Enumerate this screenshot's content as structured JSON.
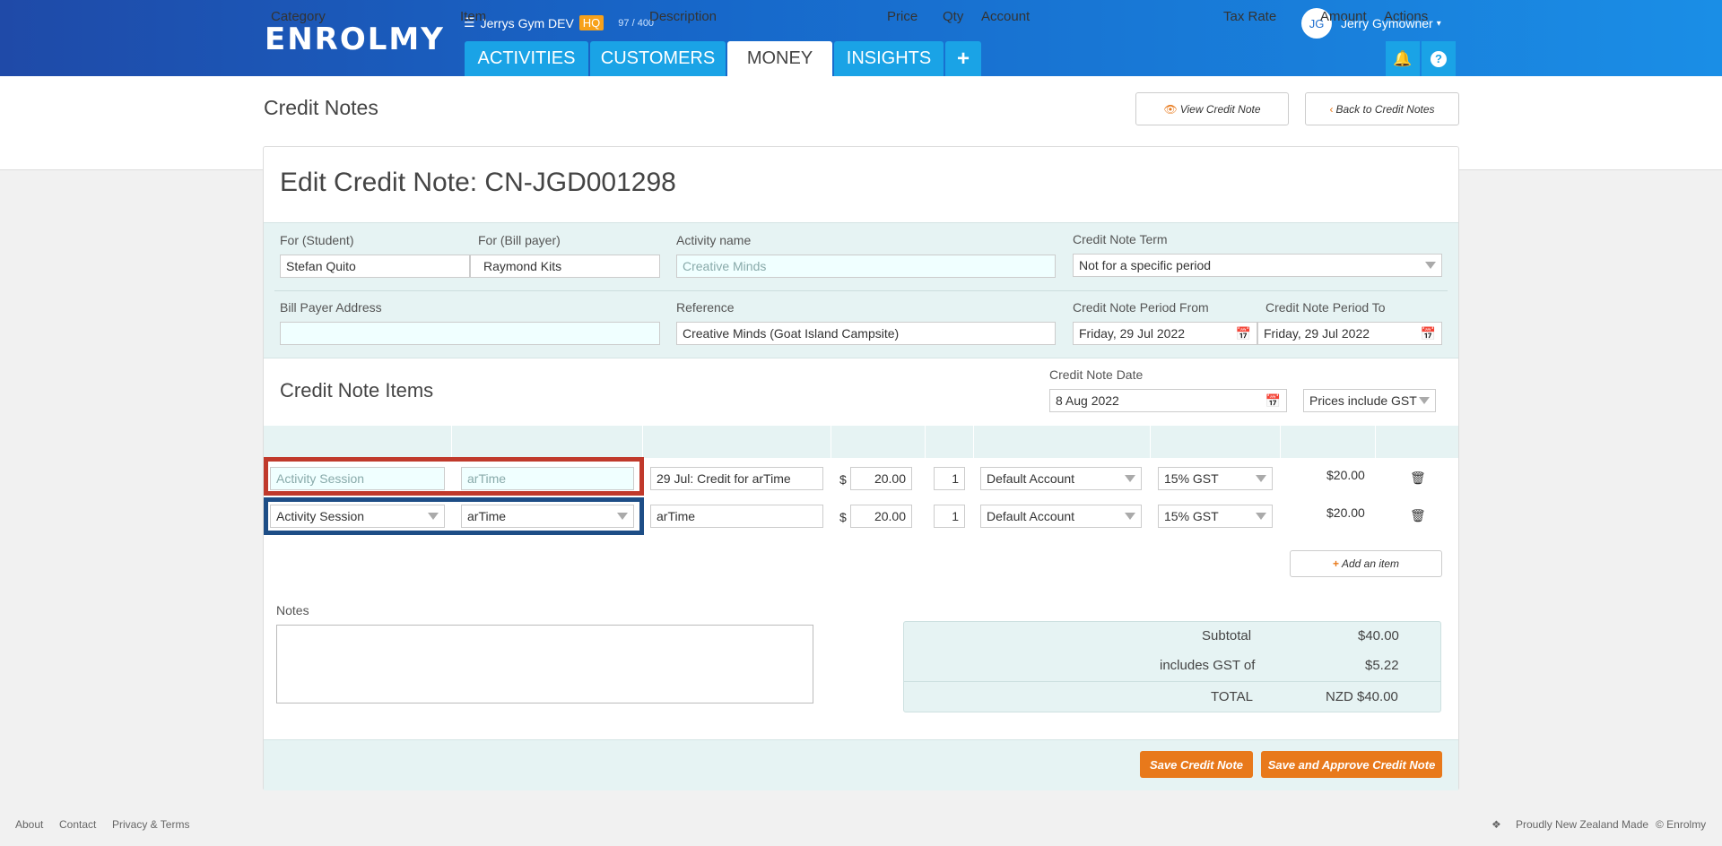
{
  "header": {
    "logo": "ENROLMY",
    "gym_name": "Jerrys Gym DEV",
    "hq_badge": "HQ",
    "quota": "97 / 400",
    "tabs": [
      {
        "label": "ACTIVITIES",
        "active": false
      },
      {
        "label": "CUSTOMERS",
        "active": false
      },
      {
        "label": "MONEY",
        "active": true
      },
      {
        "label": "INSIGHTS",
        "active": false
      }
    ],
    "add_icon": "plus-icon",
    "user_initials": "JG",
    "user_name": "Jerry Gymowner",
    "icons": [
      "bell-icon",
      "help-icon"
    ]
  },
  "page": {
    "title": "Credit Notes",
    "view_button": "View Credit Note",
    "back_button": "Back to Credit Notes"
  },
  "form": {
    "heading": "Edit Credit Note: CN-JGD001298",
    "for_student_label": "For (Student)",
    "for_student": "Stefan Quito",
    "for_bill_payer_label": "For (Bill payer)",
    "for_bill_payer": "Raymond Kits",
    "activity_name_label": "Activity name",
    "activity_name": "Creative Minds",
    "term_label": "Credit Note Term",
    "term": "Not for a specific period",
    "bill_payer_address_label": "Bill Payer Address",
    "bill_payer_address": "",
    "reference_label": "Reference",
    "reference": "Creative Minds (Goat Island Campsite)",
    "period_from_label": "Credit Note Period From",
    "period_from": "Friday, 29 Jul 2022",
    "period_to_label": "Credit Note Period To",
    "period_to": "Friday, 29 Jul 2022"
  },
  "items": {
    "title": "Credit Note Items",
    "date_label": "Credit Note Date",
    "date": "8 Aug 2022",
    "gst_mode": "Prices include GST",
    "columns": {
      "category": "Category",
      "item": "Item",
      "description": "Description",
      "price": "Price",
      "qty": "Qty",
      "account": "Account",
      "tax_rate": "Tax Rate",
      "amount": "Amount",
      "actions": "Actions"
    },
    "rows": [
      {
        "category": "Activity Session",
        "item": "arTime",
        "description": "29 Jul: Credit for arTime",
        "currency": "$",
        "price": "20.00",
        "qty": "1",
        "account": "Default Account",
        "tax_rate": "15% GST",
        "amount": "$20.00"
      },
      {
        "category": "Activity Session",
        "item": "arTime",
        "description": "arTime",
        "currency": "$",
        "price": "20.00",
        "qty": "1",
        "account": "Default Account",
        "tax_rate": "15% GST",
        "amount": "$20.00"
      }
    ],
    "add_item": "Add an item"
  },
  "notes": {
    "label": "Notes",
    "value": ""
  },
  "totals": {
    "subtotal_label": "Subtotal",
    "subtotal": "$40.00",
    "gst_label": "includes GST of",
    "gst": "$5.22",
    "total_label": "TOTAL",
    "total": "NZD $40.00"
  },
  "actions": {
    "save": "Save Credit Note",
    "save_approve": "Save and Approve Credit Note"
  },
  "footer": {
    "links": [
      "About",
      "Contact",
      "Privacy & Terms"
    ],
    "made": "Proudly New Zealand Made",
    "copyright": "© Enrolmy"
  },
  "colors": {
    "header_gradient_start": "#1f4aa8",
    "header_gradient_end": "#1a8ee6",
    "tab_blue": "#1aa3e6",
    "accent_orange": "#e8791b",
    "panel_teal": "#e6f3f3",
    "highlight_red": "#c0392b",
    "highlight_blue": "#1d4d86"
  }
}
